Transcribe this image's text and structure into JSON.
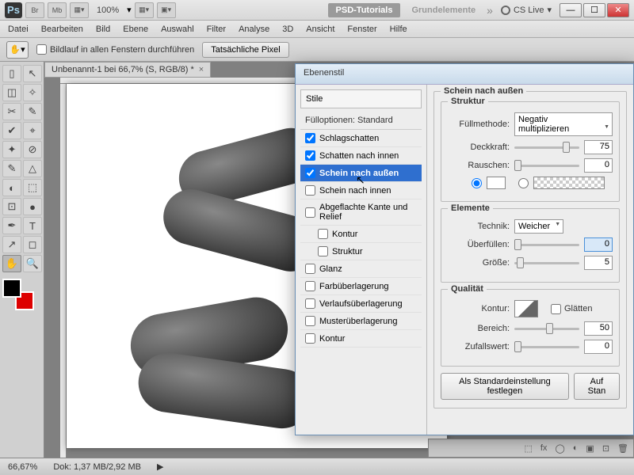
{
  "topbar": {
    "ps": "Ps",
    "br": "Br",
    "mb": "Mb",
    "zoom": "100%",
    "arrows": "▾",
    "psd_tut": "PSD-Tutorials",
    "grund": "Grundelemente",
    "chev": "»",
    "cslive": "CS Live",
    "cslive_arrow": "▾",
    "min": "―",
    "max": "☐",
    "close": "✕"
  },
  "menu": [
    "Datei",
    "Bearbeiten",
    "Bild",
    "Ebene",
    "Auswahl",
    "Filter",
    "Analyse",
    "3D",
    "Ansicht",
    "Fenster",
    "Hilfe"
  ],
  "optbar": {
    "scroll_all": "Bildlauf in allen Fenstern durchführen",
    "actual": "Tatsächliche Pixel"
  },
  "doc_tab": {
    "title": "Unbenannt-1 bei 66,7% (S, RGB/8) *",
    "x": "×"
  },
  "status": {
    "zoom": "66,67%",
    "doksize": "Dok: 1,37 MB/2,92 MB",
    "arrow": "▶"
  },
  "dialog": {
    "title": "Ebenenstil",
    "stile": "Stile",
    "fullopt": "Fülloptionen: Standard",
    "items": [
      {
        "label": "Schlagschatten",
        "checked": true
      },
      {
        "label": "Schatten nach innen",
        "checked": true
      },
      {
        "label": "Schein nach außen",
        "checked": true,
        "selected": true
      },
      {
        "label": "Schein nach innen",
        "checked": false
      },
      {
        "label": "Abgeflachte Kante und Relief",
        "checked": false
      },
      {
        "label": "Kontur",
        "checked": false,
        "indent": true
      },
      {
        "label": "Struktur",
        "checked": false,
        "indent": true
      },
      {
        "label": "Glanz",
        "checked": false
      },
      {
        "label": "Farbüberlagerung",
        "checked": false
      },
      {
        "label": "Verlaufsüberlagerung",
        "checked": false
      },
      {
        "label": "Musterüberlagerung",
        "checked": false
      },
      {
        "label": "Kontur",
        "checked": false
      }
    ],
    "section_title": "Schein nach außen",
    "struktur": "Struktur",
    "fullmethode_lbl": "Füllmethode:",
    "fullmethode_val": "Negativ multiplizieren",
    "deckkraft_lbl": "Deckkraft:",
    "deckkraft_val": "75",
    "rauschen_lbl": "Rauschen:",
    "rauschen_val": "0",
    "elemente": "Elemente",
    "technik_lbl": "Technik:",
    "technik_val": "Weicher",
    "uberfullen_lbl": "Überfüllen:",
    "uberfullen_val": "0",
    "grosse_lbl": "Größe:",
    "grosse_val": "5",
    "qualitat": "Qualität",
    "kontur_lbl": "Kontur:",
    "glatten": "Glätten",
    "bereich_lbl": "Bereich:",
    "bereich_val": "50",
    "zufall_lbl": "Zufallswert:",
    "zufall_val": "0",
    "std_btn": "Als Standardeinstellung festlegen",
    "reset_btn": "Auf Stan"
  },
  "tools": [
    "▯",
    "↖",
    "◫",
    "✧",
    "✂",
    "✎",
    "✔",
    "⌖",
    "✦",
    "⊘",
    "✎",
    "△",
    "◐",
    "⬚",
    "⊡",
    "●",
    "✒",
    "T",
    "↗",
    "◻",
    "✋",
    "🔍"
  ],
  "layers_icons": [
    "⬚",
    "fx",
    "◯",
    "◐",
    "▣",
    "⊡",
    "🗑"
  ]
}
